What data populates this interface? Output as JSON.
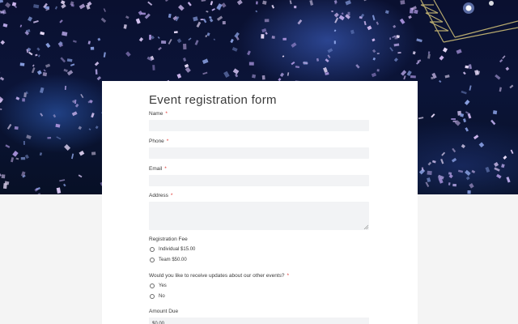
{
  "form": {
    "title": "Event registration form",
    "required_mark": "*",
    "fields": {
      "name": {
        "label": "Name",
        "value": ""
      },
      "phone": {
        "label": "Phone",
        "value": ""
      },
      "email": {
        "label": "Email",
        "value": ""
      },
      "address": {
        "label": "Address",
        "value": ""
      }
    },
    "fee": {
      "label": "Registration Fee",
      "options": [
        "Individual $15.00",
        "Team $50.00"
      ]
    },
    "updates": {
      "label": "Would you like to receive updates about our other events?",
      "options": [
        "Yes",
        "No"
      ]
    },
    "amount_due": {
      "label": "Amount Due",
      "value": "$0.00"
    }
  },
  "colors": {
    "required": "#e0342f",
    "field_bg": "#f2f3f5",
    "page_bg": "#f4f4f4"
  }
}
